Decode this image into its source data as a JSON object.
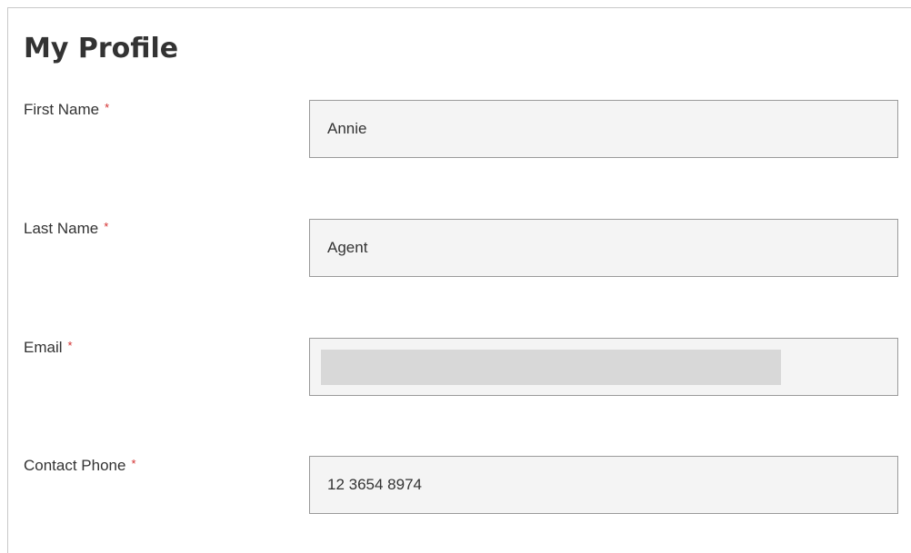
{
  "page": {
    "title": "My Profile"
  },
  "form": {
    "required_symbol": "*",
    "fields": [
      {
        "label": "First Name",
        "value": "Annie",
        "required": true
      },
      {
        "label": "Last Name",
        "value": "Agent",
        "required": true
      },
      {
        "label": "Email",
        "value": "",
        "required": true,
        "redacted": true
      },
      {
        "label": "Contact Phone",
        "value": "12 3654 8974",
        "required": true
      }
    ]
  },
  "colors": {
    "required_mark": "#d32f2f",
    "field_background": "#f4f4f4",
    "field_border": "#9a9a9a",
    "redaction": "#d8d8d8",
    "text": "#333333"
  }
}
